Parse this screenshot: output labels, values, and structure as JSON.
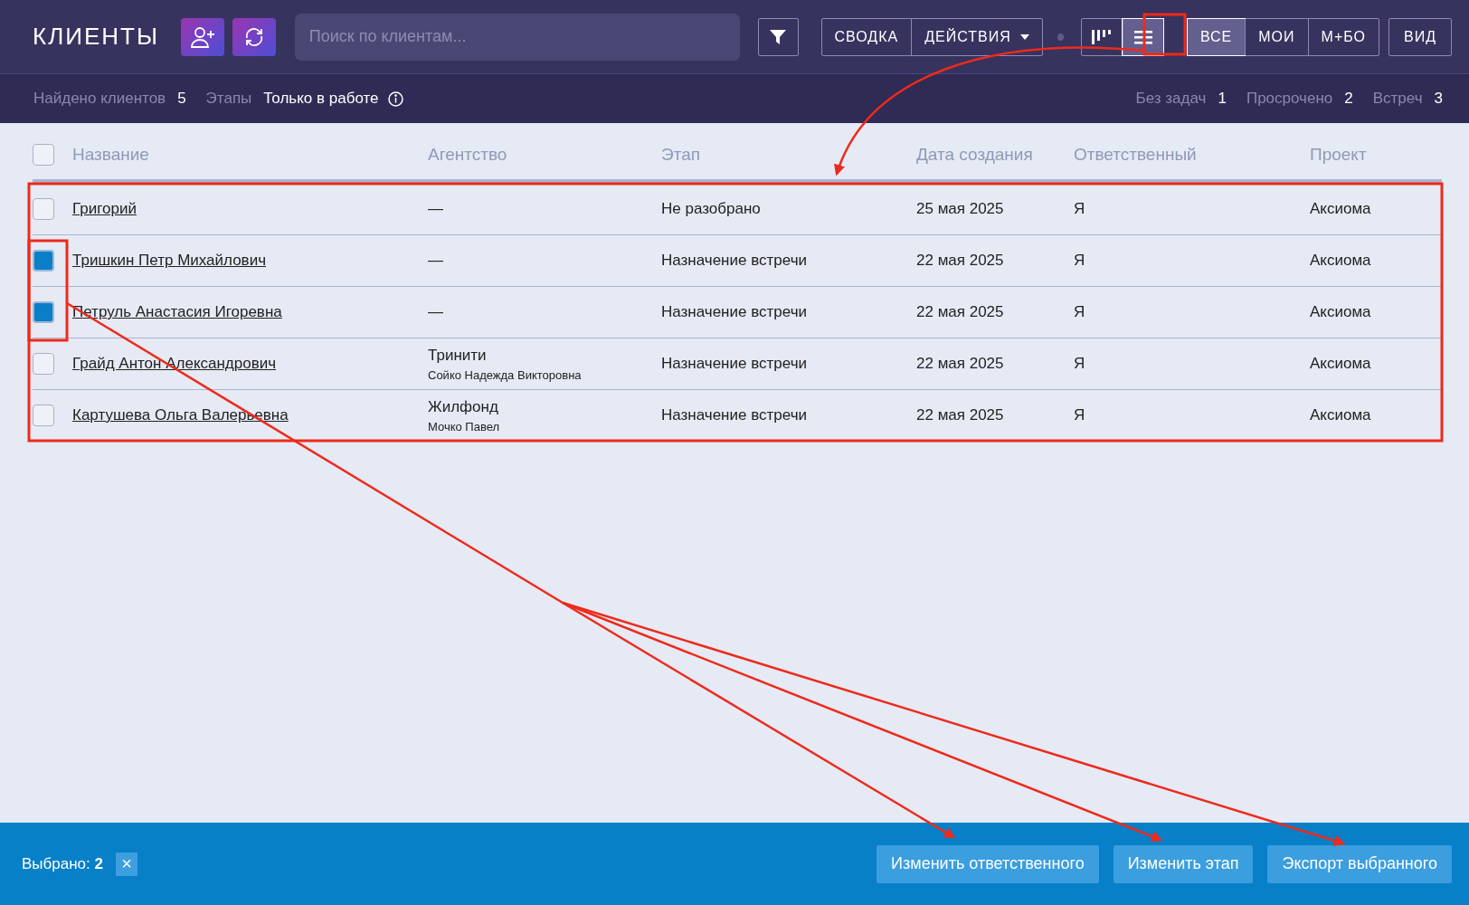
{
  "header": {
    "title": "КЛИЕНТЫ",
    "search": {
      "placeholder": "Поиск по клиентам..."
    },
    "report_buttons": [
      {
        "label": "СВОДКА",
        "kind": "plain"
      },
      {
        "label": "ДЕЙСТВИЯ",
        "kind": "dropdown"
      }
    ],
    "view_modes": [
      {
        "kind": "board",
        "selected": false
      },
      {
        "kind": "list",
        "selected": true
      }
    ],
    "scopes": [
      {
        "label": "ВСЕ",
        "selected": true
      },
      {
        "label": "МОИ",
        "selected": false
      },
      {
        "label": "М+БО",
        "selected": false
      }
    ],
    "view_button": "ВИД"
  },
  "summary": {
    "found_label": "Найдено клиентов",
    "found_count": "5",
    "stages_label": "Этапы",
    "stages_value": "Только в работе",
    "stats": [
      {
        "label": "Без задач",
        "value": "1"
      },
      {
        "label": "Просрочено",
        "value": "2"
      },
      {
        "label": "Встреч",
        "value": "3"
      }
    ]
  },
  "table": {
    "select_all_checked": false,
    "columns": [
      "Название",
      "Агентство",
      "Этап",
      "Дата создания",
      "Ответственный",
      "Проект"
    ],
    "rows": [
      {
        "checked": false,
        "name": "Григорий",
        "agency": "—",
        "stage": "Не разобрано",
        "created": "25 мая 2025",
        "owner": "Я",
        "project": "Аксиома"
      },
      {
        "checked": true,
        "name": "Тришкин Петр Михайлович",
        "agency": "—",
        "stage": "Назначение встречи",
        "created": "22 мая 2025",
        "owner": "Я",
        "project": "Аксиома"
      },
      {
        "checked": true,
        "name": "Петруль Анастасия Игоревна",
        "agency": "—",
        "stage": "Назначение встречи",
        "created": "22 мая 2025",
        "owner": "Я",
        "project": "Аксиома"
      },
      {
        "checked": false,
        "name": "Грайд Антон Александрович",
        "agency": "Тринити",
        "agent": "Сойко Надежда Викторовна",
        "stage": "Назначение встречи",
        "created": "22 мая 2025",
        "owner": "Я",
        "project": "Аксиома"
      },
      {
        "checked": false,
        "name": "Картушева Ольга Валерьевна",
        "agency": "Жилфонд",
        "agent": "Мочко Павел",
        "stage": "Назначение встречи",
        "created": "22 мая 2025",
        "owner": "Я",
        "project": "Аксиома"
      }
    ]
  },
  "selection_bar": {
    "label": "Выбрано:",
    "count": "2",
    "close": "×",
    "actions": [
      "Изменить ответственного",
      "Изменить этап",
      "Экспорт выбранного"
    ]
  }
}
